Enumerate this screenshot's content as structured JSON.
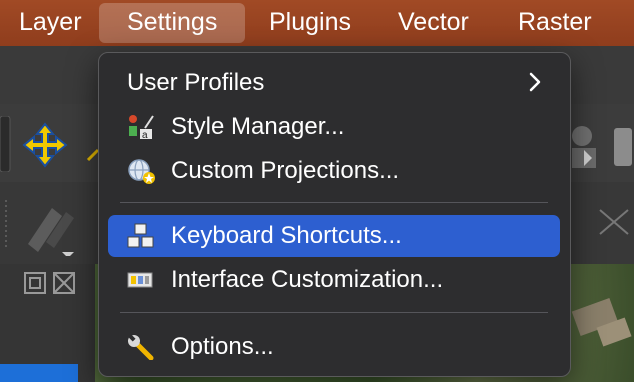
{
  "menubar": {
    "items": [
      "Layer",
      "Settings",
      "Plugins",
      "Vector",
      "Raster"
    ]
  },
  "settings_menu": {
    "items": [
      {
        "label": "User Profiles",
        "icon": "chevron-right-icon",
        "submenu": true
      },
      {
        "label": "Style Manager...",
        "icon": "style-manager-icon"
      },
      {
        "label": "Custom Projections...",
        "icon": "globe-projection-icon"
      },
      {
        "label": "Keyboard Shortcuts...",
        "icon": "keyboard-shortcuts-icon",
        "highlighted": true
      },
      {
        "label": "Interface Customization...",
        "icon": "interface-customization-icon"
      },
      {
        "label": "Options...",
        "icon": "wrench-icon"
      }
    ]
  },
  "colors": {
    "menubar": "#9a4421",
    "menu_background": "#2d2d2f",
    "highlight": "#2d5fd0"
  }
}
